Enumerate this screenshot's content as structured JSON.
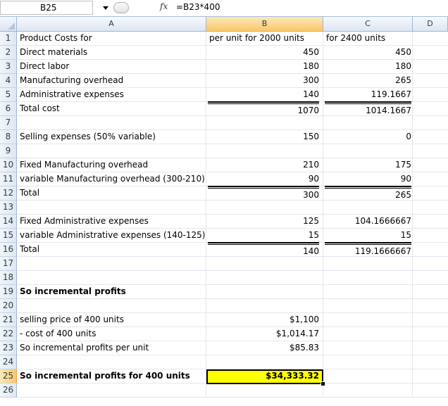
{
  "formula_bar": {
    "name_box": "B25",
    "fx_label": "fx",
    "formula": "=B23*400"
  },
  "columns": [
    "A",
    "B",
    "C",
    "D"
  ],
  "rows": [
    {
      "n": "1",
      "a": "Product Costs for",
      "b": "per unit for 2000 units",
      "c": "for 2400 units"
    },
    {
      "n": "2",
      "a": "Direct materials",
      "b": "450",
      "c": "450"
    },
    {
      "n": "3",
      "a": "Direct labor",
      "b": "180",
      "c": "180"
    },
    {
      "n": "4",
      "a": "Manufacturing overhead",
      "b": "300",
      "c": "265"
    },
    {
      "n": "5",
      "a": "Administrative expenses",
      "b": "140",
      "c": "119.1667"
    },
    {
      "n": "6",
      "a": "Total cost",
      "b": "1070",
      "c": "1014.1667"
    },
    {
      "n": "7",
      "a": "",
      "b": "",
      "c": ""
    },
    {
      "n": "8",
      "a": "Selling expenses (50% variable)",
      "b": "150",
      "c": "0"
    },
    {
      "n": "9",
      "a": "",
      "b": "",
      "c": ""
    },
    {
      "n": "10",
      "a": "Fixed Manufacturing overhead",
      "b": "210",
      "c": "175"
    },
    {
      "n": "11",
      "a": "variable Manufacturing overhead (300-210)",
      "b": "90",
      "c": "90"
    },
    {
      "n": "12",
      "a": "Total",
      "b": "300",
      "c": "265"
    },
    {
      "n": "13",
      "a": "",
      "b": "",
      "c": ""
    },
    {
      "n": "14",
      "a": "Fixed Administrative expenses",
      "b": "125",
      "c": "104.1666667"
    },
    {
      "n": "15",
      "a": "variable Administrative expenses (140-125)",
      "b": "15",
      "c": "15"
    },
    {
      "n": "16",
      "a": "Total",
      "b": "140",
      "c": "119.1666667"
    },
    {
      "n": "17",
      "a": "",
      "b": "",
      "c": ""
    },
    {
      "n": "18",
      "a": "",
      "b": "",
      "c": ""
    },
    {
      "n": "19",
      "a": "So incremental profits",
      "b": "",
      "c": ""
    },
    {
      "n": "20",
      "a": "",
      "b": "",
      "c": ""
    },
    {
      "n": "21",
      "a": "selling price of 400 units",
      "b": "$1,100",
      "c": ""
    },
    {
      "n": "22",
      "a": " - cost of 400 units",
      "b": "$1,014.17",
      "c": ""
    },
    {
      "n": "23",
      "a": "So incremental profits per unit",
      "b": "$85.83",
      "c": ""
    },
    {
      "n": "24",
      "a": "",
      "b": "",
      "c": ""
    },
    {
      "n": "25",
      "a": "So incremental profits for 400 units",
      "b": "$34,333.32",
      "c": ""
    },
    {
      "n": "26",
      "a": "",
      "b": "",
      "c": ""
    }
  ],
  "colors": {
    "selected_fill": "#ffff00",
    "header_selected": "#f9c76c"
  }
}
